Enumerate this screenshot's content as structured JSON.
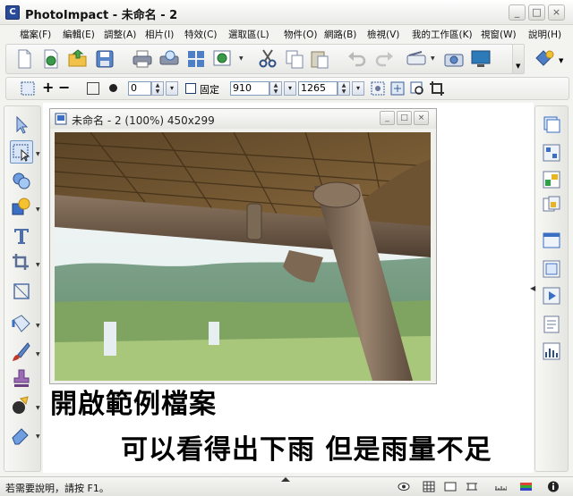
{
  "window": {
    "icon_letter": "C",
    "title": "PhotoImpact - 未命名 - 2",
    "minimize_glyph": "_",
    "maximize_glyph": "□",
    "close_glyph": "×"
  },
  "menu": {
    "items": [
      {
        "label": "檔案(F)"
      },
      {
        "label": "編輯(E)"
      },
      {
        "label": "調整(A)"
      },
      {
        "label": "相片(I)"
      },
      {
        "label": "特效(C)"
      },
      {
        "label": "選取區(L)"
      },
      {
        "label": "物件(O)"
      },
      {
        "label": "網路(B)"
      },
      {
        "label": "檢視(V)"
      },
      {
        "label": "我的工作區(K)"
      },
      {
        "label": "視窗(W)"
      },
      {
        "label": "說明(H)"
      }
    ]
  },
  "toolbar": {
    "icons": [
      "new-file-icon",
      "open-web-icon",
      "open-folder-icon",
      "save-icon",
      "print-icon",
      "print-preview-icon",
      "grid-icon",
      "web-globe-icon",
      "cut-icon",
      "copy-icon",
      "paste-icon",
      "undo-icon",
      "redo-icon",
      "scanner-icon",
      "camera-icon",
      "monitor-icon"
    ]
  },
  "options_bar": {
    "plus_label": "+",
    "minus_label": "−",
    "feather_value": "0",
    "fixed_label": "固定",
    "width_value": "910",
    "height_value": "1265"
  },
  "document": {
    "title": "未命名 - 2 (100%) 450x299",
    "minimize_glyph": "_",
    "maximize_glyph": "□",
    "close_glyph": "×"
  },
  "caption": {
    "line1": "開啟範例檔案",
    "line2": "可以看得出下雨 但是雨量不足"
  },
  "status": {
    "text": "若需要說明，請按 F1。"
  },
  "colors": {
    "accent": "#2a4a9a",
    "selection": "#d6e4f6"
  }
}
